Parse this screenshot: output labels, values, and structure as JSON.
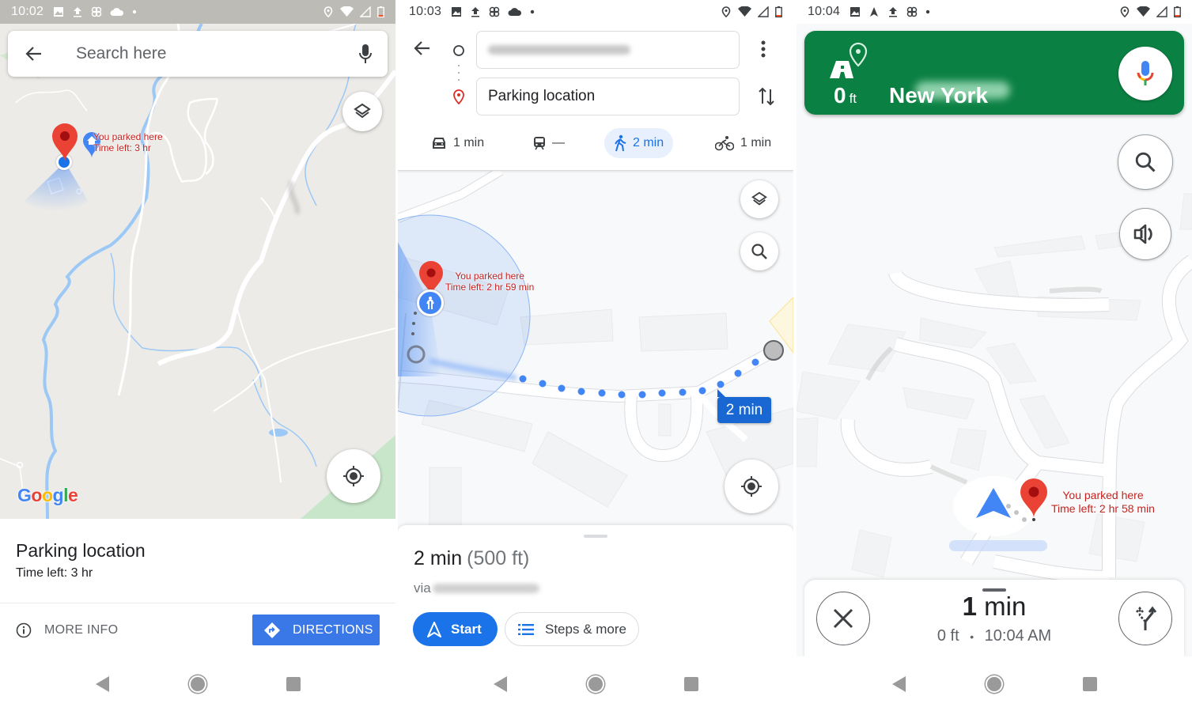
{
  "screen1": {
    "status": {
      "time": "10:02",
      "left_icons": [
        "image-icon",
        "upload-icon",
        "pinwheel-icon",
        "cloud-icon",
        "dot-icon"
      ],
      "right_icons": [
        "location-icon",
        "wifi-icon",
        "signal-icon",
        "battery-icon"
      ]
    },
    "search": {
      "placeholder": "Search here"
    },
    "map": {
      "pin_label_line1": "You parked here",
      "pin_label_line2": "Time left: 3 hr",
      "logo": [
        "G",
        "o",
        "o",
        "g",
        "l",
        "e"
      ],
      "logo_colors": [
        "#4285f4",
        "#ea4335",
        "#fbbc05",
        "#4285f4",
        "#34a853",
        "#ea4335"
      ]
    },
    "sheet": {
      "title": "Parking location",
      "subtitle": "Time left: 3 hr",
      "more_info": "MORE INFO",
      "directions": "DIRECTIONS"
    }
  },
  "screen2": {
    "status": {
      "time": "10:03",
      "left_icons": [
        "image-icon",
        "upload-icon",
        "pinwheel-icon",
        "cloud-icon",
        "dot-icon"
      ],
      "right_icons": [
        "location-icon",
        "wifi-icon",
        "signal-icon",
        "battery-icon"
      ]
    },
    "origin": {
      "value": "[redacted address]"
    },
    "destination": {
      "value": "Parking location"
    },
    "modes": [
      {
        "name": "drive",
        "label": "1 min",
        "active": false
      },
      {
        "name": "transit",
        "label": "—",
        "active": false
      },
      {
        "name": "walk",
        "label": "2 min",
        "active": true
      },
      {
        "name": "bike",
        "label": "1 min",
        "active": false
      }
    ],
    "map": {
      "pin_label_line1": "You parked here",
      "pin_label_line2": "Time left: 2 hr 59 min",
      "eta_bubble": "2 min"
    },
    "sheet": {
      "duration": "2 min",
      "distance": "(500 ft)",
      "via": "via",
      "start": "Start",
      "steps": "Steps & more"
    }
  },
  "screen3": {
    "status": {
      "time": "10:04",
      "left_icons": [
        "image-icon",
        "navigation-icon",
        "upload-icon",
        "pinwheel-icon",
        "dot-icon"
      ],
      "right_icons": [
        "location-icon",
        "wifi-icon",
        "signal-icon",
        "battery-icon"
      ]
    },
    "nav": {
      "distance_value": "0",
      "distance_unit": "ft",
      "street": "New York",
      "color": "#0b8043"
    },
    "map": {
      "pin_label_line1": "You parked here",
      "pin_label_line2": "Time left: 2 hr 58 min"
    },
    "sheet": {
      "minutes_value": "1",
      "minutes_unit": "min",
      "remaining_distance": "0 ft",
      "separator": "•",
      "arrival": "10:04 AM"
    }
  },
  "colors": {
    "accent_blue": "#1a73e8",
    "pin_red": "#ea4335",
    "label_red": "#c5221f",
    "nav_green": "#0b8043"
  }
}
